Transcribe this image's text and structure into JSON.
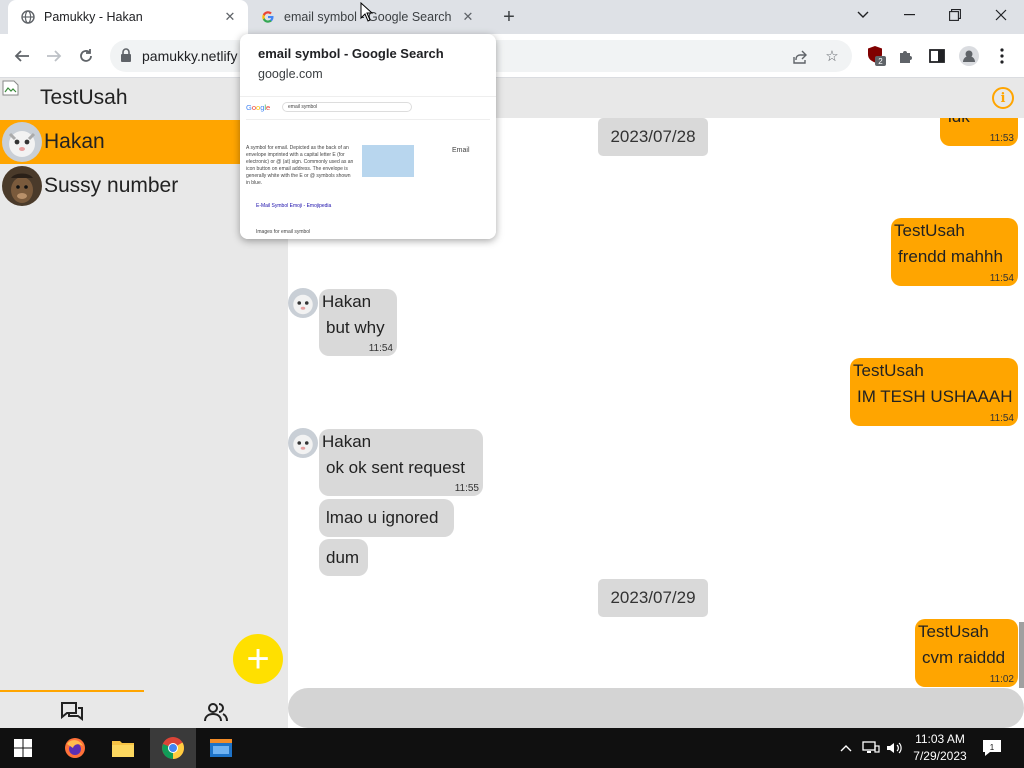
{
  "browser": {
    "tabs": [
      {
        "title": "Pamukky - Hakan",
        "favicon": "globe-icon",
        "active": true
      },
      {
        "title": "email symbol - Google Search",
        "favicon": "google-g-icon",
        "active": false
      }
    ],
    "url": "pamukky.netlify",
    "hover_card": {
      "title": "email symbol - Google Search",
      "domain": "google.com",
      "preview": {
        "search_box": "email symbol",
        "snippet_lines": [
          "A symbol for email. Depicted as the back of an",
          "envelope imprinted with a capital letter E (for",
          "electronic) or @ (at) sign. Commonly used as an",
          "icon button on email address. The envelope is",
          "generally white with the E or @ symbols shown",
          "in blue."
        ],
        "knowledge_title": "Email",
        "link_text": "E-Mail Symbol Emoji - Emojipedia",
        "footer": "Images for email symbol"
      }
    }
  },
  "app": {
    "current_user": "TestUsah",
    "contacts": [
      {
        "name": "Hakan",
        "selected": true
      },
      {
        "name": "Sussy number",
        "selected": false
      }
    ],
    "fab_label": "+",
    "chat": {
      "items": [
        {
          "kind": "message",
          "dir": "out",
          "text": "idk",
          "time": "11:53"
        },
        {
          "kind": "date",
          "text": "2023/07/28"
        },
        {
          "kind": "message",
          "dir": "out",
          "sender": "TestUsah",
          "text": "frendd mahhh",
          "time": "11:54"
        },
        {
          "kind": "message",
          "dir": "in",
          "sender": "Hakan",
          "text": "but why",
          "time": "11:54"
        },
        {
          "kind": "message",
          "dir": "out",
          "sender": "TestUsah",
          "text": "IM TESH USHAAAH",
          "time": "11:54"
        },
        {
          "kind": "message",
          "dir": "in",
          "sender": "Hakan",
          "text": "ok ok sent request",
          "time": "11:55"
        },
        {
          "kind": "message",
          "dir": "in",
          "text": "lmao u ignored"
        },
        {
          "kind": "message",
          "dir": "in",
          "text": "dum"
        },
        {
          "kind": "date",
          "text": "2023/07/29"
        },
        {
          "kind": "message",
          "dir": "out",
          "sender": "TestUsah",
          "text": "cvm raiddd",
          "time": "11:02"
        }
      ]
    }
  },
  "taskbar": {
    "time": "11:03 AM",
    "date": "7/29/2023",
    "notification_count": "1"
  },
  "colors": {
    "accent": "#ffa500",
    "fab": "#ffe000",
    "incoming_bubble": "#d9d9d9"
  }
}
